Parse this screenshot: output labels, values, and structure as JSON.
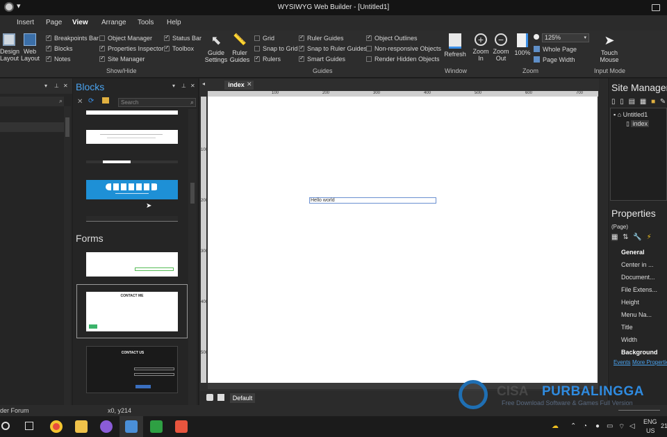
{
  "window": {
    "title": "WYSIWYG Web Builder - [Untitled1]"
  },
  "menu": {
    "tabs": [
      "Insert",
      "Page",
      "View",
      "Arrange",
      "Tools",
      "Help"
    ],
    "active": "View"
  },
  "ribbon": {
    "design_layout": "Design Layout",
    "web_layout": "Web Layout",
    "show_hide": {
      "col1": [
        "Breakpoints Bar",
        "Blocks",
        "Notes"
      ],
      "col2": [
        "Object Manager",
        "Properties Inspector",
        "Site Manager"
      ],
      "col3": [
        "Status Bar",
        "Toolbox"
      ],
      "label": "Show/Hide"
    },
    "guide_settings": "Guide Settings",
    "ruler_guides": "Ruler Guides",
    "guides": {
      "col1": [
        "Grid",
        "Snap to Grid",
        "Rulers"
      ],
      "col2": [
        "Ruler Guides",
        "Snap to Ruler Guides",
        "Smart Guides"
      ],
      "col3": [
        "Object Outlines",
        "Non-responsive Objects",
        "Render Hidden Objects"
      ],
      "label": "Guides"
    },
    "refresh": "Refresh",
    "window_label": "Window",
    "zoom_in": "Zoom In",
    "zoom_out": "Zoom Out",
    "zoom_100": "100%",
    "zoom_value": "125%",
    "whole_page": "Whole Page",
    "page_width": "Page Width",
    "zoom_label": "Zoom",
    "touch_mouse": "Touch Mouse",
    "input_mode": "Input Mode"
  },
  "blocks": {
    "title": "Blocks",
    "search_placeholder": "Search",
    "forms_label": "Forms",
    "contact_title": "CONTACT ME",
    "contact_title_dark": "CONTACT US"
  },
  "editor": {
    "tab": "index",
    "element_text": "Hello world",
    "ruler_h": [
      "100",
      "200",
      "300",
      "400",
      "500",
      "600",
      "700"
    ],
    "ruler_v": [
      "100",
      "200",
      "300",
      "400",
      "500"
    ],
    "breakpoint_tab": "Default"
  },
  "site_manager": {
    "title": "Site Manager",
    "root": "Untitled1",
    "page": "index"
  },
  "properties": {
    "title": "Properties",
    "subtitle": "(Page)",
    "category_general": "General",
    "rows": [
      "Center in ...",
      "Document...",
      "File Extens...",
      "Height",
      "Menu Na...",
      "Title",
      "Width"
    ],
    "category_background": "Background",
    "events_link": "Events",
    "more_link": "More Properties"
  },
  "status": {
    "left": "der Forum",
    "coords": "x0, y214"
  },
  "taskbar": {
    "lang": "ENG",
    "region": "US",
    "clock": "21"
  },
  "watermark": {
    "brand": "PURBALINGGA",
    "ghost": "CISA",
    "tagline": "Free Download Software & Games Full Version"
  },
  "colors": {
    "accent": "#3a8ee6",
    "panel_bg": "#252525",
    "ribbon_bg": "#2d2d2d",
    "blocks_title": "#4aa3ef"
  }
}
